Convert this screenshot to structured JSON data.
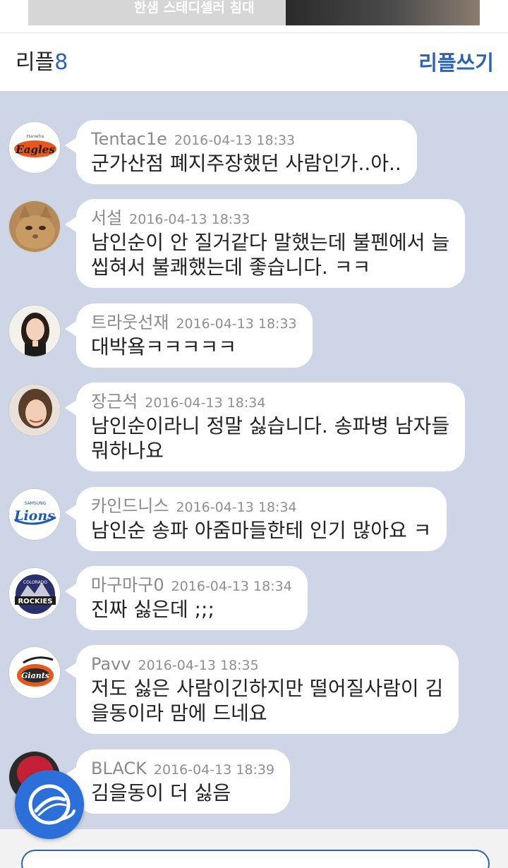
{
  "ad": {
    "text": "한샘 스테디셀러 침대"
  },
  "reply_header": {
    "title": "리플",
    "count": "8",
    "write_label": "리플쓰기"
  },
  "comments": [
    {
      "author": "Tentac1e",
      "time": "2016-04-13 18:33",
      "lines": [
        "군가산점 폐지주장했던 사람인가..아.."
      ],
      "avatar": "eagles-logo"
    },
    {
      "author": "서설",
      "time": "2016-04-13 18:33",
      "lines": [
        "남인순이 안 질거같다 말했는데 불펜에서 늘",
        "씹혀서 불쾌했는데 좋습니다. ㅋㅋ"
      ],
      "avatar": "cat-photo"
    },
    {
      "author": "트라웃선재",
      "time": "2016-04-13 18:33",
      "lines": [
        "대박욬ㅋㅋㅋㅋㅋ"
      ],
      "avatar": "woman-photo"
    },
    {
      "author": "장근석",
      "time": "2016-04-13 18:34",
      "lines": [
        "남인순이라니 정말 싫습니다. 송파병 남자들",
        "뭐하나요"
      ],
      "avatar": "man-photo"
    },
    {
      "author": "카인드니스",
      "time": "2016-04-13 18:34",
      "lines": [
        "남인순 송파 아줌마들한테 인기 많아요 ㅋ"
      ],
      "avatar": "lions-logo"
    },
    {
      "author": "마구마구0",
      "time": "2016-04-13 18:34",
      "lines": [
        "진짜 싫은데 ;;;"
      ],
      "avatar": "rockies-logo"
    },
    {
      "author": "Pavv",
      "time": "2016-04-13 18:35",
      "lines": [
        "저도 싫은 사람이긴하지만 떨어질사람이 김",
        "을동이라 맘에 드네요"
      ],
      "avatar": "giants-logo"
    },
    {
      "author": "BLACK",
      "time": "2016-04-13 18:39",
      "lines": [
        "김을동이 더 싫음"
      ],
      "avatar": "red-avatar"
    }
  ],
  "colors": {
    "accent": "#2f63b0",
    "comment_background": "#cdd5e6",
    "fab": "#2d6fd8"
  }
}
